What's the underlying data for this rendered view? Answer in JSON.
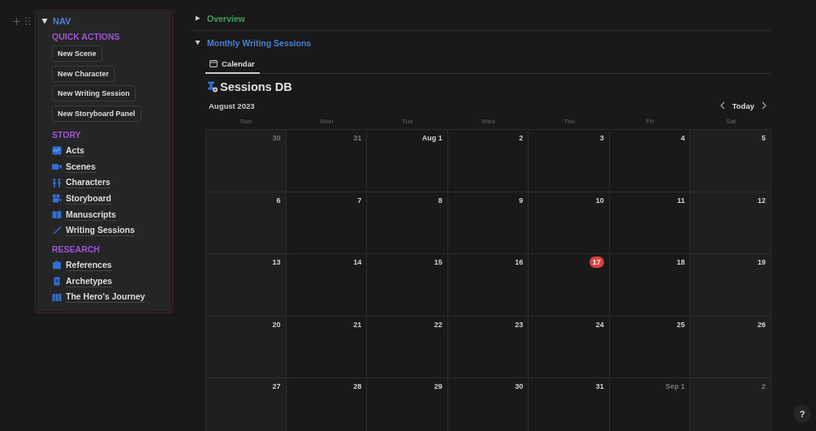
{
  "nav": {
    "title": "NAV",
    "expanded": true,
    "quick_actions": {
      "heading": "QUICK ACTIONS",
      "buttons": [
        "New Scene",
        "New Character",
        "New Writing Session",
        "New Storyboard Panel"
      ]
    },
    "sections": [
      {
        "heading": "STORY",
        "items": [
          {
            "label": "Acts",
            "kind": "chart"
          },
          {
            "label": "Scenes",
            "kind": "video"
          },
          {
            "label": "Characters",
            "kind": "people"
          },
          {
            "label": "Storyboard",
            "kind": "camera"
          },
          {
            "label": "Manuscripts",
            "kind": "book"
          },
          {
            "label": "Writing Sessions",
            "kind": "brush"
          }
        ]
      },
      {
        "heading": "RESEARCH",
        "items": [
          {
            "label": "References",
            "kind": "clipboard"
          },
          {
            "label": "Archetypes",
            "kind": "phone"
          },
          {
            "label": "The Hero's Journey",
            "kind": "map"
          }
        ]
      }
    ]
  },
  "toggles": [
    {
      "title": "Overview",
      "expanded": false,
      "color": "#3f9d62"
    },
    {
      "title": "Monthly Writing Sessions",
      "expanded": true,
      "color": "#4a7fd6"
    }
  ],
  "view_tabs": [
    {
      "label": "Calendar",
      "selected": true
    }
  ],
  "database": {
    "title": "Sessions DB"
  },
  "calendar": {
    "month": "August 2023",
    "today_button": "Today",
    "weekdays": [
      "Sun",
      "Mon",
      "Tue",
      "Wed",
      "Thu",
      "Fri",
      "Sat"
    ],
    "days": [
      {
        "label": "30",
        "in_month": false,
        "today": false
      },
      {
        "label": "31",
        "in_month": false,
        "today": false
      },
      {
        "label": "Aug 1",
        "in_month": true,
        "today": false
      },
      {
        "label": "2",
        "in_month": true,
        "today": false
      },
      {
        "label": "3",
        "in_month": true,
        "today": false
      },
      {
        "label": "4",
        "in_month": true,
        "today": false
      },
      {
        "label": "5",
        "in_month": true,
        "today": false
      },
      {
        "label": "6",
        "in_month": true,
        "today": false
      },
      {
        "label": "7",
        "in_month": true,
        "today": false
      },
      {
        "label": "8",
        "in_month": true,
        "today": false
      },
      {
        "label": "9",
        "in_month": true,
        "today": false
      },
      {
        "label": "10",
        "in_month": true,
        "today": false
      },
      {
        "label": "11",
        "in_month": true,
        "today": false
      },
      {
        "label": "12",
        "in_month": true,
        "today": false
      },
      {
        "label": "13",
        "in_month": true,
        "today": false
      },
      {
        "label": "14",
        "in_month": true,
        "today": false
      },
      {
        "label": "15",
        "in_month": true,
        "today": false
      },
      {
        "label": "16",
        "in_month": true,
        "today": false
      },
      {
        "label": "17",
        "in_month": true,
        "today": true
      },
      {
        "label": "18",
        "in_month": true,
        "today": false
      },
      {
        "label": "19",
        "in_month": true,
        "today": false
      },
      {
        "label": "20",
        "in_month": true,
        "today": false
      },
      {
        "label": "21",
        "in_month": true,
        "today": false
      },
      {
        "label": "22",
        "in_month": true,
        "today": false
      },
      {
        "label": "23",
        "in_month": true,
        "today": false
      },
      {
        "label": "24",
        "in_month": true,
        "today": false
      },
      {
        "label": "25",
        "in_month": true,
        "today": false
      },
      {
        "label": "26",
        "in_month": true,
        "today": false
      },
      {
        "label": "27",
        "in_month": true,
        "today": false
      },
      {
        "label": "28",
        "in_month": true,
        "today": false
      },
      {
        "label": "29",
        "in_month": true,
        "today": false
      },
      {
        "label": "30",
        "in_month": true,
        "today": false
      },
      {
        "label": "31",
        "in_month": true,
        "today": false
      },
      {
        "label": "Sep 1",
        "in_month": false,
        "today": false
      },
      {
        "label": "2",
        "in_month": false,
        "today": false
      }
    ]
  },
  "help_button": "?"
}
